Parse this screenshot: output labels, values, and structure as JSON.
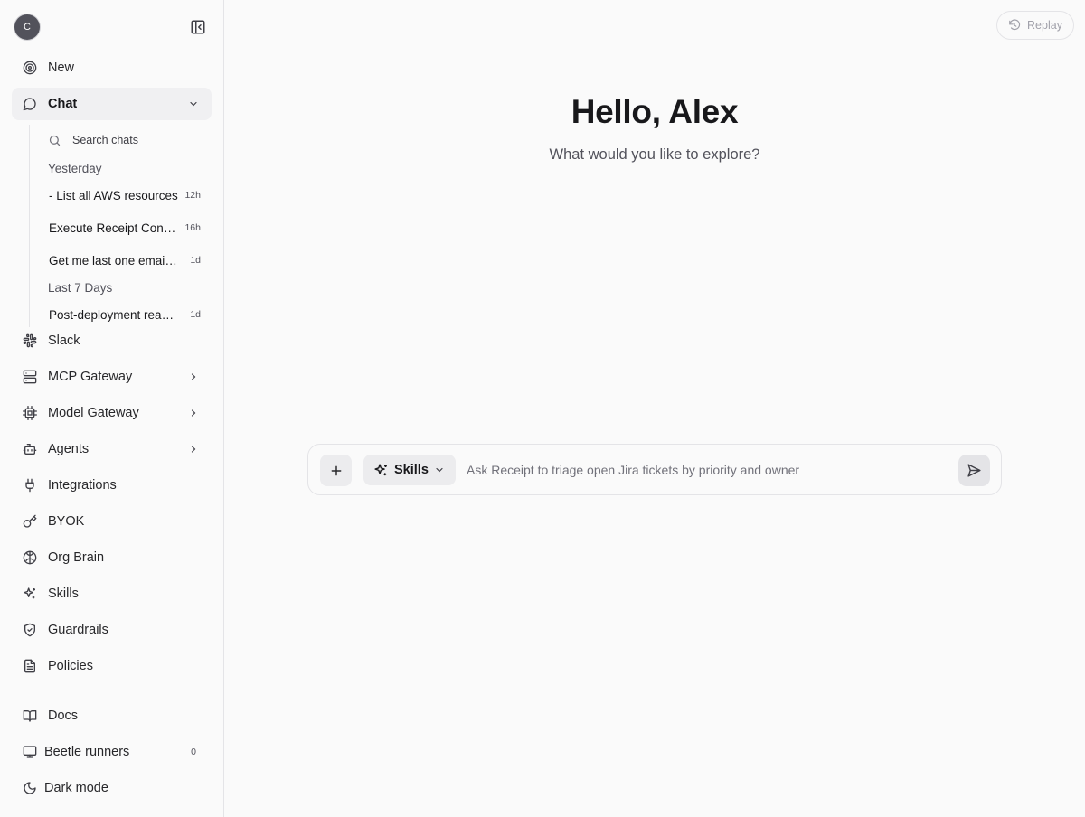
{
  "user": {
    "avatar_initial": "C",
    "greeting": "Hello, Alex",
    "subtitle": "What would you like to explore?"
  },
  "header": {
    "replay_label": "Replay"
  },
  "sidebar": {
    "new_label": "New",
    "chat_label": "Chat",
    "search_chats_label": "Search chats",
    "groups": [
      {
        "label": "Yesterday",
        "chats": [
          {
            "title": "- List all AWS resources",
            "age": "12h"
          },
          {
            "title": "Execute Receipt Connector",
            "age": "16h"
          },
          {
            "title": "Get me last one email from inbox",
            "age": "1d"
          }
        ]
      },
      {
        "label": "Last 7 Days",
        "chats": [
          {
            "title": "Post-deployment readiness",
            "age": "1d"
          }
        ]
      }
    ],
    "items": [
      {
        "label": "Slack"
      },
      {
        "label": "MCP Gateway"
      },
      {
        "label": "Model Gateway"
      },
      {
        "label": "Agents"
      },
      {
        "label": "Integrations"
      },
      {
        "label": "BYOK"
      },
      {
        "label": "Org Brain"
      },
      {
        "label": "Skills"
      },
      {
        "label": "Guardrails"
      },
      {
        "label": "Policies"
      }
    ],
    "footer": [
      {
        "label": "Docs"
      },
      {
        "label": "Beetle runners",
        "count": "0"
      },
      {
        "label": "Dark mode"
      }
    ]
  },
  "composer": {
    "skills_label": "Skills",
    "placeholder": "Ask Receipt to triage open Jira tickets by priority and owner"
  }
}
